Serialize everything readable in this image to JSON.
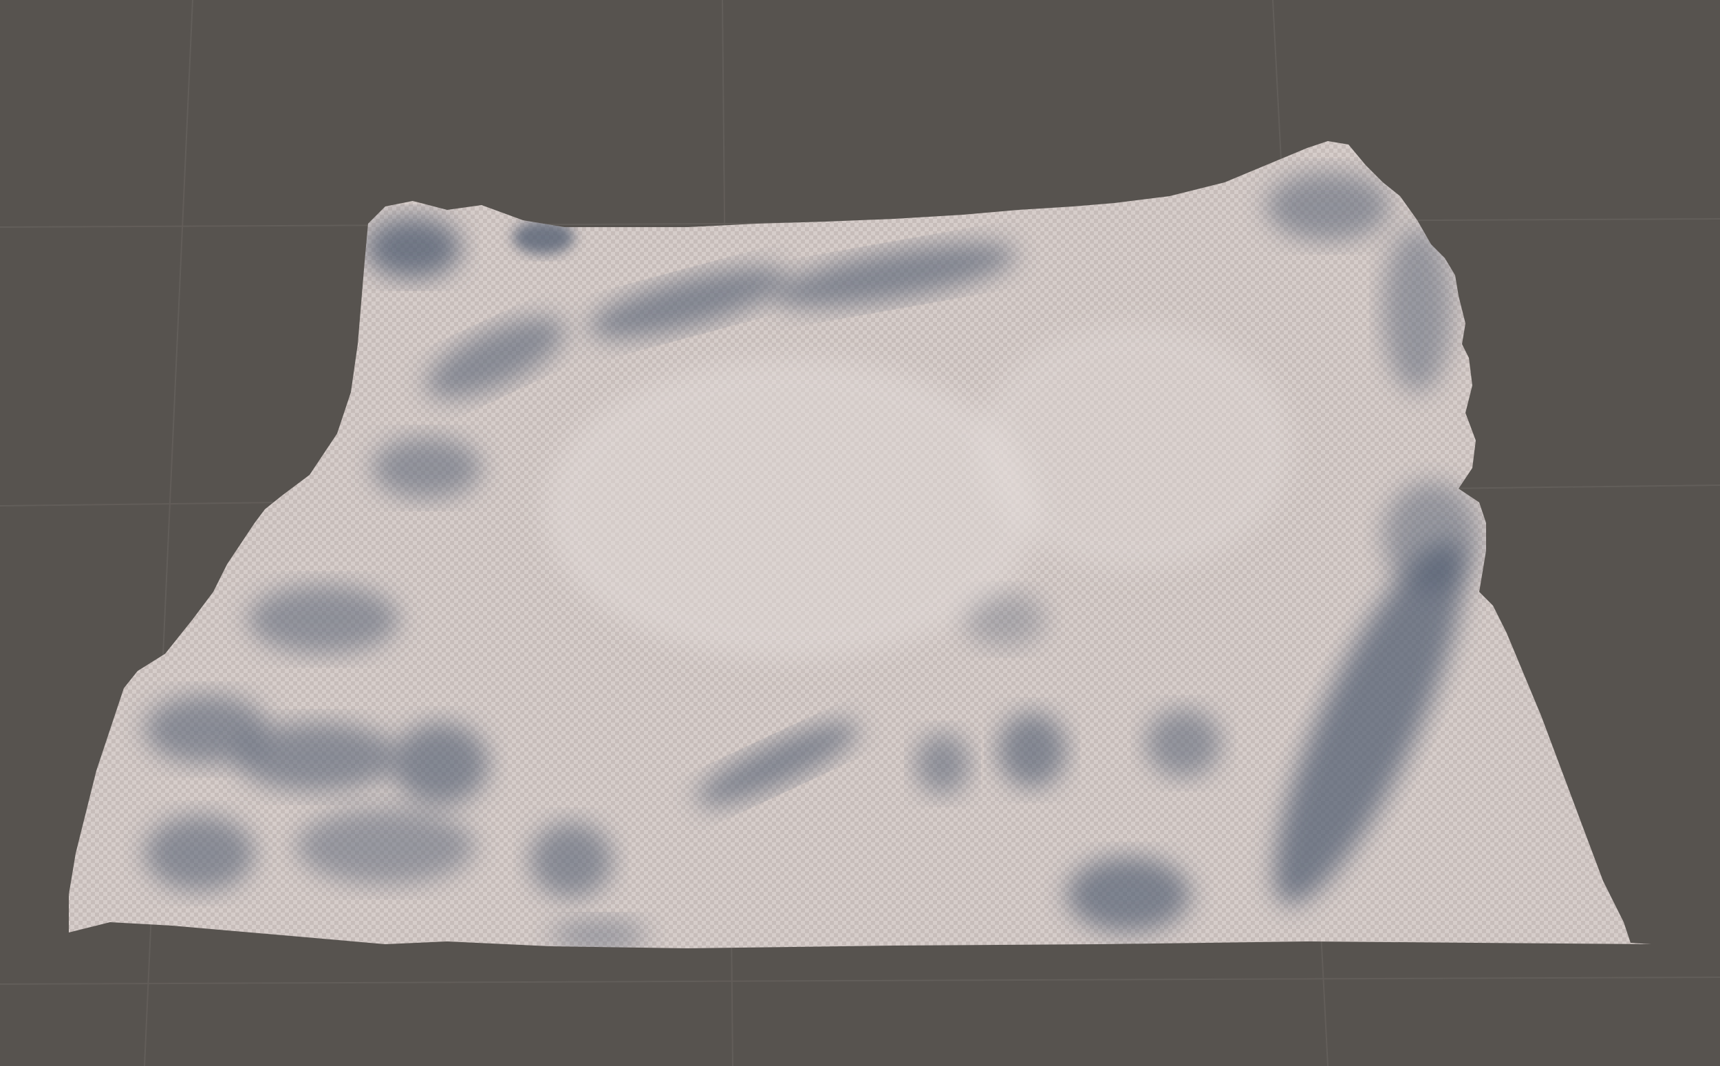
{
  "scene": {
    "view": "scene-viewport",
    "object": "terrain-mesh",
    "material": "checker-grid",
    "colors": {
      "background": "#57534f",
      "grid_line": "#6a6662",
      "terrain_light": "#d9d0cd",
      "terrain_mid": "#bfb4b2",
      "terrain_shadow": "#4f5b70",
      "checker_a": "#d6cdca",
      "checker_b": "#c7bdba"
    }
  }
}
